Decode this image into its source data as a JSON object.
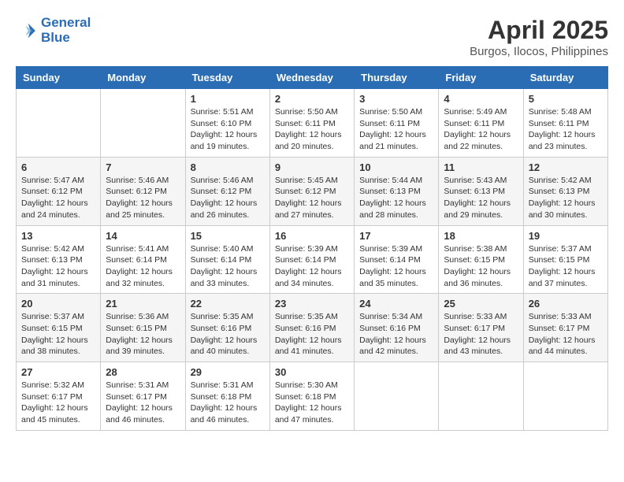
{
  "logo": {
    "line1": "General",
    "line2": "Blue"
  },
  "title": "April 2025",
  "location": "Burgos, Ilocos, Philippines",
  "days_of_week": [
    "Sunday",
    "Monday",
    "Tuesday",
    "Wednesday",
    "Thursday",
    "Friday",
    "Saturday"
  ],
  "weeks": [
    [
      {
        "day": "",
        "info": ""
      },
      {
        "day": "",
        "info": ""
      },
      {
        "day": "1",
        "info": "Sunrise: 5:51 AM\nSunset: 6:10 PM\nDaylight: 12 hours\nand 19 minutes."
      },
      {
        "day": "2",
        "info": "Sunrise: 5:50 AM\nSunset: 6:11 PM\nDaylight: 12 hours\nand 20 minutes."
      },
      {
        "day": "3",
        "info": "Sunrise: 5:50 AM\nSunset: 6:11 PM\nDaylight: 12 hours\nand 21 minutes."
      },
      {
        "day": "4",
        "info": "Sunrise: 5:49 AM\nSunset: 6:11 PM\nDaylight: 12 hours\nand 22 minutes."
      },
      {
        "day": "5",
        "info": "Sunrise: 5:48 AM\nSunset: 6:11 PM\nDaylight: 12 hours\nand 23 minutes."
      }
    ],
    [
      {
        "day": "6",
        "info": "Sunrise: 5:47 AM\nSunset: 6:12 PM\nDaylight: 12 hours\nand 24 minutes."
      },
      {
        "day": "7",
        "info": "Sunrise: 5:46 AM\nSunset: 6:12 PM\nDaylight: 12 hours\nand 25 minutes."
      },
      {
        "day": "8",
        "info": "Sunrise: 5:46 AM\nSunset: 6:12 PM\nDaylight: 12 hours\nand 26 minutes."
      },
      {
        "day": "9",
        "info": "Sunrise: 5:45 AM\nSunset: 6:12 PM\nDaylight: 12 hours\nand 27 minutes."
      },
      {
        "day": "10",
        "info": "Sunrise: 5:44 AM\nSunset: 6:13 PM\nDaylight: 12 hours\nand 28 minutes."
      },
      {
        "day": "11",
        "info": "Sunrise: 5:43 AM\nSunset: 6:13 PM\nDaylight: 12 hours\nand 29 minutes."
      },
      {
        "day": "12",
        "info": "Sunrise: 5:42 AM\nSunset: 6:13 PM\nDaylight: 12 hours\nand 30 minutes."
      }
    ],
    [
      {
        "day": "13",
        "info": "Sunrise: 5:42 AM\nSunset: 6:13 PM\nDaylight: 12 hours\nand 31 minutes."
      },
      {
        "day": "14",
        "info": "Sunrise: 5:41 AM\nSunset: 6:14 PM\nDaylight: 12 hours\nand 32 minutes."
      },
      {
        "day": "15",
        "info": "Sunrise: 5:40 AM\nSunset: 6:14 PM\nDaylight: 12 hours\nand 33 minutes."
      },
      {
        "day": "16",
        "info": "Sunrise: 5:39 AM\nSunset: 6:14 PM\nDaylight: 12 hours\nand 34 minutes."
      },
      {
        "day": "17",
        "info": "Sunrise: 5:39 AM\nSunset: 6:14 PM\nDaylight: 12 hours\nand 35 minutes."
      },
      {
        "day": "18",
        "info": "Sunrise: 5:38 AM\nSunset: 6:15 PM\nDaylight: 12 hours\nand 36 minutes."
      },
      {
        "day": "19",
        "info": "Sunrise: 5:37 AM\nSunset: 6:15 PM\nDaylight: 12 hours\nand 37 minutes."
      }
    ],
    [
      {
        "day": "20",
        "info": "Sunrise: 5:37 AM\nSunset: 6:15 PM\nDaylight: 12 hours\nand 38 minutes."
      },
      {
        "day": "21",
        "info": "Sunrise: 5:36 AM\nSunset: 6:15 PM\nDaylight: 12 hours\nand 39 minutes."
      },
      {
        "day": "22",
        "info": "Sunrise: 5:35 AM\nSunset: 6:16 PM\nDaylight: 12 hours\nand 40 minutes."
      },
      {
        "day": "23",
        "info": "Sunrise: 5:35 AM\nSunset: 6:16 PM\nDaylight: 12 hours\nand 41 minutes."
      },
      {
        "day": "24",
        "info": "Sunrise: 5:34 AM\nSunset: 6:16 PM\nDaylight: 12 hours\nand 42 minutes."
      },
      {
        "day": "25",
        "info": "Sunrise: 5:33 AM\nSunset: 6:17 PM\nDaylight: 12 hours\nand 43 minutes."
      },
      {
        "day": "26",
        "info": "Sunrise: 5:33 AM\nSunset: 6:17 PM\nDaylight: 12 hours\nand 44 minutes."
      }
    ],
    [
      {
        "day": "27",
        "info": "Sunrise: 5:32 AM\nSunset: 6:17 PM\nDaylight: 12 hours\nand 45 minutes."
      },
      {
        "day": "28",
        "info": "Sunrise: 5:31 AM\nSunset: 6:17 PM\nDaylight: 12 hours\nand 46 minutes."
      },
      {
        "day": "29",
        "info": "Sunrise: 5:31 AM\nSunset: 6:18 PM\nDaylight: 12 hours\nand 46 minutes."
      },
      {
        "day": "30",
        "info": "Sunrise: 5:30 AM\nSunset: 6:18 PM\nDaylight: 12 hours\nand 47 minutes."
      },
      {
        "day": "",
        "info": ""
      },
      {
        "day": "",
        "info": ""
      },
      {
        "day": "",
        "info": ""
      }
    ]
  ]
}
